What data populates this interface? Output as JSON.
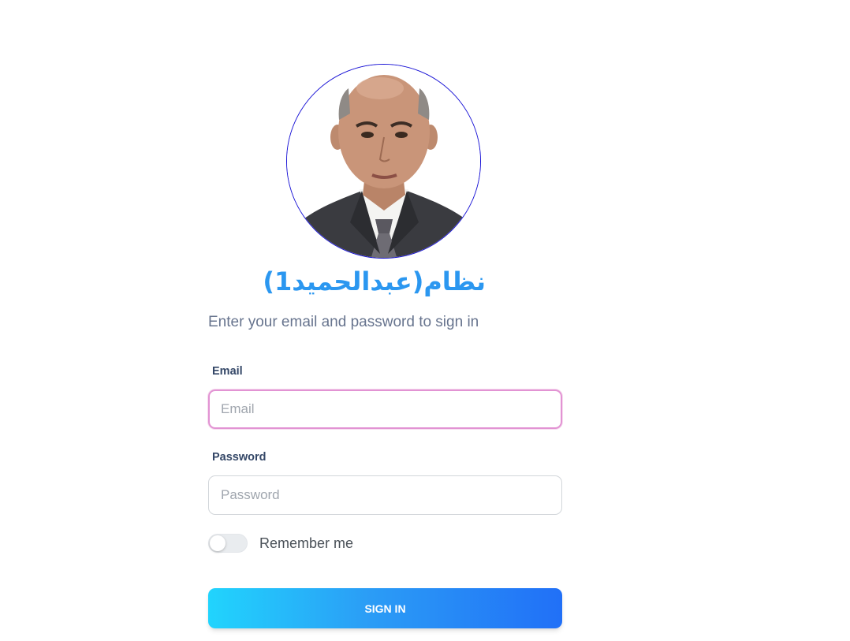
{
  "header": {
    "system_title": "نظام(عبدالحميد1)",
    "avatar_alt": "profile-photo"
  },
  "form": {
    "subtitle": "Enter your email and password to sign in",
    "email": {
      "label": "Email",
      "placeholder": "Email",
      "value": ""
    },
    "password": {
      "label": "Password",
      "placeholder": "Password",
      "value": ""
    },
    "remember": {
      "label": "Remember me",
      "checked": false
    },
    "submit_label": "SIGN IN"
  },
  "colors": {
    "title": "#2b97f0",
    "avatar_border": "#1a14d6",
    "email_focus_border": "#e293d3",
    "button_gradient_start": "#21d4fd",
    "button_gradient_end": "#2170f7",
    "subtitle": "#67748e",
    "label": "#344767"
  }
}
